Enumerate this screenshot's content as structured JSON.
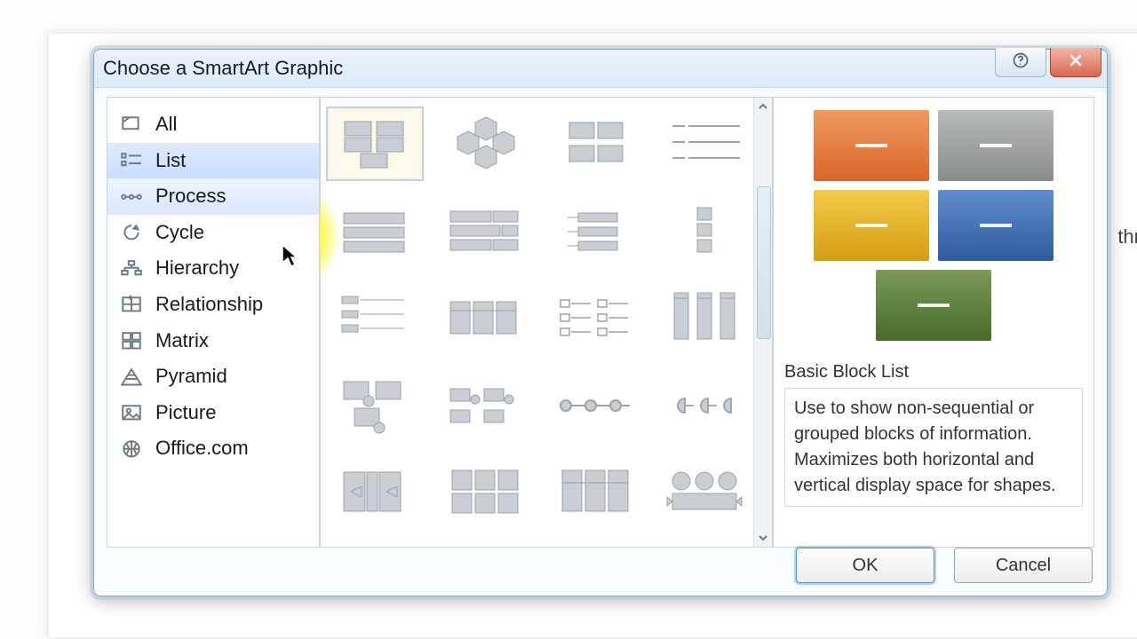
{
  "dialog": {
    "title": "Choose a SmartArt Graphic"
  },
  "sidebar": {
    "items": [
      {
        "label": "All",
        "icon": "all"
      },
      {
        "label": "List",
        "icon": "list",
        "selected": true
      },
      {
        "label": "Process",
        "icon": "process",
        "hover": true
      },
      {
        "label": "Cycle",
        "icon": "cycle"
      },
      {
        "label": "Hierarchy",
        "icon": "hierarchy"
      },
      {
        "label": "Relationship",
        "icon": "relationship"
      },
      {
        "label": "Matrix",
        "icon": "matrix"
      },
      {
        "label": "Pyramid",
        "icon": "pyramid"
      },
      {
        "label": "Picture",
        "icon": "picture"
      },
      {
        "label": "Office.com",
        "icon": "globe"
      }
    ]
  },
  "gallery": {
    "selected_index": 0,
    "count": 24
  },
  "preview": {
    "title": "Basic Block List",
    "description": "Use to show non-sequential or grouped blocks of information. Maximizes both horizontal and vertical display space for shapes.",
    "colors": [
      "#e77a3c",
      "#9b9e9e",
      "#e6b321",
      "#3b6cb3",
      "#5a7a3c"
    ]
  },
  "buttons": {
    "ok": "OK",
    "cancel": "Cancel"
  },
  "background_text": "thr"
}
